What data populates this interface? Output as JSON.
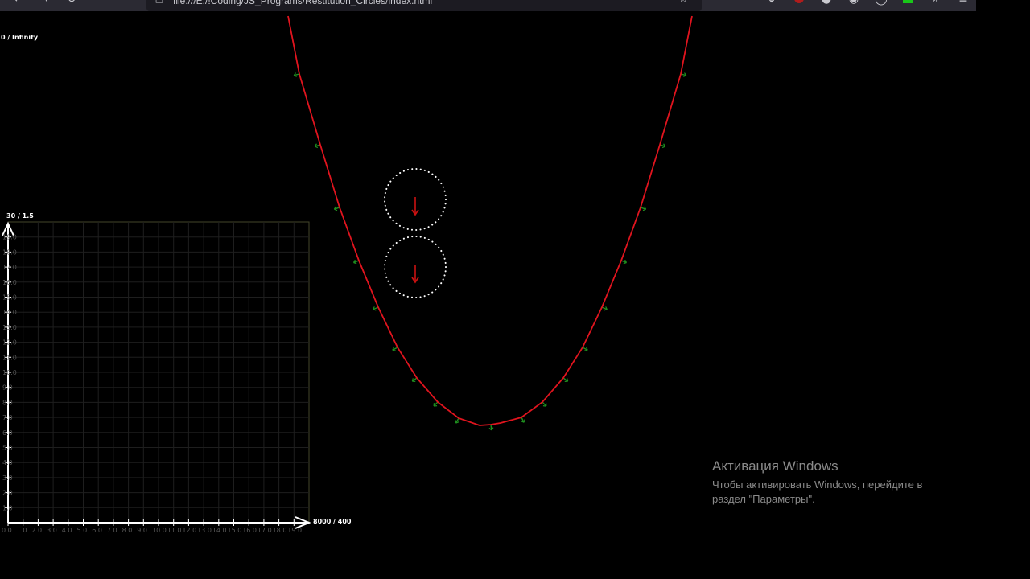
{
  "browser": {
    "url": "file:///E:/!Coding/JS_Programs/Restitution_Circles/index.html",
    "icons": [
      "back-icon",
      "forward-icon",
      "reload-icon",
      "page-icon",
      "bookmark-star-icon",
      "downloads-icon",
      "ublock-icon",
      "ghost-icon",
      "extension-icon",
      "sync-icon",
      "green-extension-icon",
      "overflow-icon",
      "menu-icon"
    ]
  },
  "canvas": {
    "corner_label": "0 / Infinity"
  },
  "chart_data": {
    "type": "line",
    "y_max_label": "30 / 1.5",
    "x_max_label": "8000 / 400",
    "y_tick_labels": [
      "1.0",
      "2.0",
      "3.0",
      "4.0",
      "5.0",
      "6.0",
      "7.0",
      "8.0",
      "9.0",
      "10.0",
      "11.0",
      "12.0",
      "13.0",
      "14.0",
      "15.0",
      "16.0",
      "17.0",
      "18.0",
      "19.0"
    ],
    "x_tick_labels": [
      "0.0",
      "1.0",
      "2.0",
      "3.0",
      "4.0",
      "5.0",
      "6.0",
      "7.0",
      "8.0",
      "9.0",
      "10.0",
      "11.0",
      "12.0",
      "13.0",
      "14.0",
      "15.0",
      "16.0",
      "17.0",
      "18.0",
      "19.0"
    ],
    "series": []
  },
  "simulation": {
    "curve_color": "#e0141e",
    "normal_color": "#1f8f1f",
    "ball_color": "#ffffff",
    "velocity_color": "#cc1111",
    "balls": [
      {
        "velocity": "down"
      },
      {
        "velocity": "down"
      }
    ]
  },
  "watermark": {
    "title": "Активация Windows",
    "line1": "Чтобы активировать Windows, перейдите в",
    "line2": "раздел \"Параметры\"."
  }
}
